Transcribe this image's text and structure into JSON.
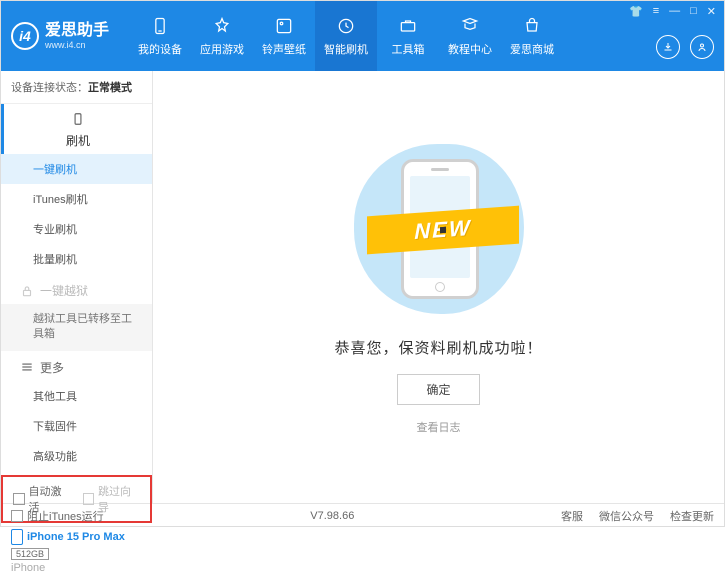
{
  "app": {
    "title": "爱思助手",
    "subtitle": "www.i4.cn"
  },
  "nav": {
    "items": [
      {
        "label": "我的设备"
      },
      {
        "label": "应用游戏"
      },
      {
        "label": "铃声壁纸"
      },
      {
        "label": "智能刷机"
      },
      {
        "label": "工具箱"
      },
      {
        "label": "教程中心"
      },
      {
        "label": "爱思商城"
      }
    ]
  },
  "status": {
    "prefix": "设备连接状态：",
    "value": "正常模式"
  },
  "sidebar": {
    "section_flash": "刷机",
    "items": {
      "one_key": "一键刷机",
      "itunes": "iTunes刷机",
      "pro": "专业刷机",
      "batch": "批量刷机"
    },
    "section_jailbreak": "一键越狱",
    "jailbreak_note": "越狱工具已转移至工具箱",
    "section_more": "更多",
    "more": {
      "other": "其他工具",
      "download": "下载固件",
      "advanced": "高级功能"
    },
    "checkboxes": {
      "auto_activate": "自动激活",
      "skip_guide": "跳过向导"
    },
    "device": {
      "name": "iPhone 15 Pro Max",
      "storage": "512GB",
      "type": "iPhone"
    }
  },
  "main": {
    "ribbon": "NEW",
    "success": "恭喜您，保资料刷机成功啦！",
    "ok": "确定",
    "log": "查看日志"
  },
  "footer": {
    "block_itunes": "阻止iTunes运行",
    "version": "V7.98.66",
    "service": "客服",
    "wechat": "微信公众号",
    "update": "检查更新"
  }
}
